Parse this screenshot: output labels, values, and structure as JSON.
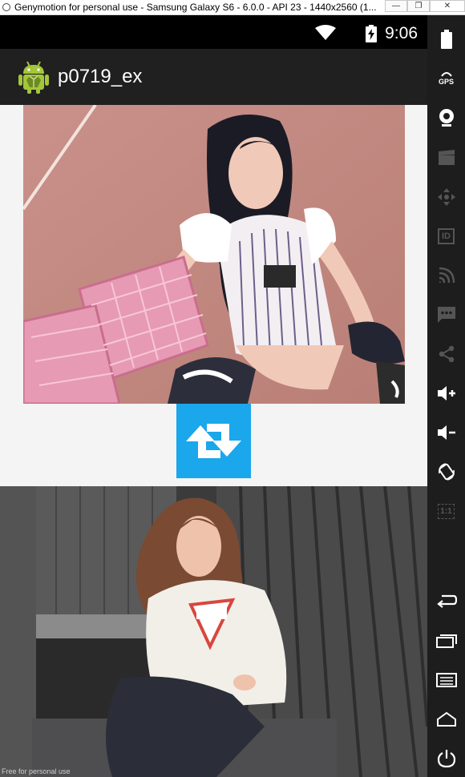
{
  "window": {
    "title": "Genymotion for personal use - Samsung Galaxy S6 - 6.0.0 - API 23 - 1440x2560 (1...",
    "buttons": [
      "minimize",
      "restore",
      "close"
    ]
  },
  "status_bar": {
    "time": "9:06",
    "icons": [
      "wifi-icon",
      "battery-charging-icon"
    ]
  },
  "app": {
    "title": "p0719_ex",
    "icon": "android-logo-icon"
  },
  "content": {
    "top_image": "photo of a woman in a striped jersey sitting by pink crates",
    "swap_button_icon": "swap-arrows-icon",
    "bottom_image": "photo of a woman in a white sweatshirt sitting on wooden steps"
  },
  "sidebar": {
    "items": [
      "battery-icon",
      "gps-icon",
      "webcam-icon",
      "clapper-icon",
      "move-icon",
      "id-icon",
      "cast-icon",
      "sms-icon",
      "share-icon",
      "volume-up-icon",
      "volume-down-icon",
      "rotate-icon",
      "scale-icon",
      "back-icon",
      "recent-apps-icon",
      "menu-icon",
      "home-icon",
      "power-icon"
    ],
    "gps_label": "GPS",
    "id_label": "ID",
    "scale_label": "1:1"
  },
  "footer_text": "Free for personal use",
  "colors": {
    "status_bar": "#000000",
    "action_bar": "#202020",
    "accent": "#1aa7ec",
    "sidebar": "#1d1d1d",
    "content_bg": "#f4f4f4"
  }
}
